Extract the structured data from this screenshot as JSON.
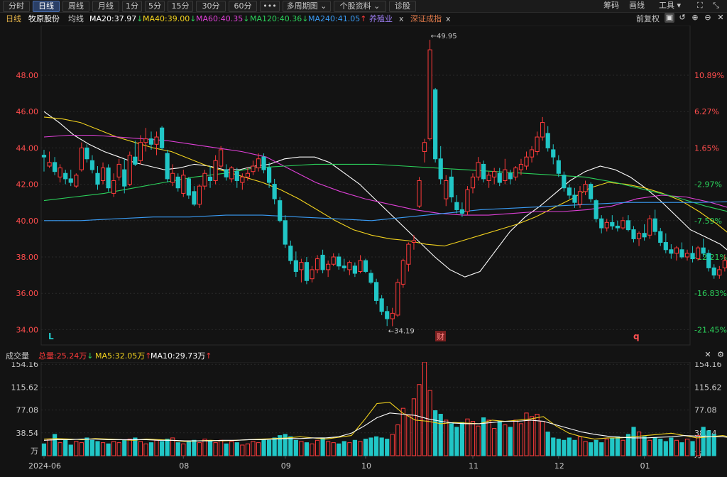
{
  "toolbar": {
    "periods": [
      "分时",
      "日线",
      "周线",
      "月线",
      "1分",
      "5分",
      "15分",
      "30分",
      "60分",
      "•••",
      "多周期图",
      "个股资料",
      "诊股"
    ],
    "active_period": "日线",
    "right_items": [
      "筹码",
      "画线",
      "工具"
    ]
  },
  "header": {
    "period": "日线",
    "stock_name": "牧原股份",
    "avg_label": "均线",
    "ma_items": [
      {
        "label": "MA20:37.97",
        "arrow": "↓",
        "color": "#ffffff"
      },
      {
        "label": "MA40:39.00",
        "arrow": "↓",
        "color": "#f2d21e"
      },
      {
        "label": "MA60:40.35",
        "arrow": "↓",
        "color": "#e040d8"
      },
      {
        "label": "MA120:40.36",
        "arrow": "↓",
        "color": "#2bd15b"
      },
      {
        "label": "MA240:41.05",
        "arrow": "↑",
        "color": "#3a9cf5"
      }
    ],
    "tags": [
      {
        "label": "养殖业",
        "close": "x",
        "color": "#9b7cf0"
      },
      {
        "label": "深证成指",
        "close": "x",
        "color": "#e07a4a"
      }
    ],
    "adjust": "前复权"
  },
  "chart_data": {
    "type": "candlestick",
    "price_axis": {
      "ticks": [
        48,
        46,
        44,
        42,
        40,
        38,
        36,
        34
      ],
      "labels": [
        "48.00",
        "46.00",
        "44.00",
        "42.00",
        "40.00",
        "38.00",
        "36.00",
        "34.00"
      ],
      "range": [
        33.6,
        50.2
      ]
    },
    "pct_axis": {
      "labels": [
        "10.89%",
        "6.27%",
        "1.65%",
        "-2.97%",
        "-7.59%",
        "-12.21%",
        "-16.83%",
        "-21.45%"
      ]
    },
    "x_labels": [
      "2024-06",
      "08",
      "09",
      "10",
      "11",
      "12",
      "01"
    ],
    "annotations": {
      "high": "49.95",
      "low": "34.19"
    },
    "markers": [
      "L",
      "财",
      "q"
    ],
    "up_color": "#ff3b3b",
    "down_color": "#21c6c6",
    "candles": [
      [
        43.6,
        43.9,
        42.7,
        43.5
      ],
      [
        43.0,
        43.8,
        42.9,
        43.2
      ],
      [
        43.2,
        43.5,
        42.5,
        42.7
      ],
      [
        42.4,
        43.1,
        42.1,
        42.9
      ],
      [
        42.6,
        42.8,
        42.0,
        42.3
      ],
      [
        42.3,
        42.8,
        41.9,
        42.1
      ],
      [
        41.9,
        42.6,
        41.8,
        42.5
      ],
      [
        42.8,
        44.3,
        42.7,
        44.0
      ],
      [
        44.0,
        44.2,
        43.2,
        43.4
      ],
      [
        43.3,
        43.6,
        42.6,
        42.8
      ],
      [
        42.6,
        43.0,
        41.7,
        42.0
      ],
      [
        42.2,
        43.2,
        42.0,
        42.9
      ],
      [
        42.9,
        43.1,
        41.6,
        41.8
      ],
      [
        41.5,
        42.6,
        41.3,
        42.2
      ],
      [
        42.4,
        43.4,
        42.2,
        43.1
      ],
      [
        42.8,
        43.4,
        41.5,
        41.9
      ],
      [
        42.0,
        43.8,
        41.9,
        43.6
      ],
      [
        43.5,
        44.4,
        43.0,
        43.1
      ],
      [
        43.3,
        44.7,
        43.1,
        44.3
      ],
      [
        44.3,
        45.1,
        43.8,
        44.5
      ],
      [
        44.5,
        44.9,
        43.9,
        44.2
      ],
      [
        44.2,
        44.9,
        43.6,
        44.6
      ],
      [
        45.1,
        45.2,
        43.9,
        44.0
      ],
      [
        43.7,
        43.9,
        42.1,
        42.3
      ],
      [
        42.1,
        43.1,
        41.9,
        42.6
      ],
      [
        42.4,
        42.6,
        41.6,
        41.8
      ],
      [
        41.5,
        42.8,
        41.3,
        42.5
      ],
      [
        42.3,
        42.4,
        41.2,
        41.4
      ],
      [
        41.6,
        41.9,
        40.8,
        40.9
      ],
      [
        40.9,
        42.0,
        40.7,
        41.9
      ],
      [
        41.9,
        42.8,
        41.7,
        42.6
      ],
      [
        42.4,
        43.0,
        41.8,
        42.2
      ],
      [
        42.2,
        43.6,
        42.0,
        43.3
      ],
      [
        43.0,
        44.1,
        42.9,
        43.9
      ],
      [
        42.8,
        43.1,
        42.2,
        42.4
      ],
      [
        42.3,
        43.0,
        42.1,
        42.9
      ],
      [
        42.7,
        42.9,
        41.8,
        42.2
      ],
      [
        42.1,
        42.6,
        41.7,
        42.4
      ],
      [
        42.4,
        42.9,
        42.2,
        42.6
      ],
      [
        42.7,
        43.3,
        42.5,
        43.0
      ],
      [
        42.9,
        43.7,
        42.7,
        43.4
      ],
      [
        43.5,
        43.7,
        42.6,
        42.8
      ],
      [
        42.9,
        43.2,
        41.8,
        42.1
      ],
      [
        42.0,
        42.3,
        40.9,
        41.2
      ],
      [
        41.1,
        41.3,
        39.9,
        40.0
      ],
      [
        40.0,
        40.3,
        38.5,
        38.7
      ],
      [
        38.6,
        38.9,
        37.6,
        37.8
      ],
      [
        37.8,
        38.3,
        36.9,
        37.2
      ],
      [
        37.3,
        37.9,
        36.6,
        37.7
      ],
      [
        37.7,
        38.0,
        36.5,
        36.7
      ],
      [
        36.8,
        37.5,
        36.6,
        37.3
      ],
      [
        37.3,
        38.1,
        37.1,
        37.9
      ],
      [
        38.1,
        38.4,
        37.1,
        37.3
      ],
      [
        37.3,
        37.8,
        36.9,
        37.6
      ],
      [
        37.6,
        38.2,
        37.5,
        38.0
      ],
      [
        38.0,
        38.2,
        37.3,
        37.5
      ],
      [
        37.5,
        37.9,
        37.2,
        37.4
      ],
      [
        37.3,
        37.8,
        37.0,
        37.7
      ],
      [
        37.5,
        37.7,
        36.9,
        37.1
      ],
      [
        37.2,
        38.1,
        37.1,
        37.8
      ],
      [
        37.8,
        37.9,
        37.1,
        37.2
      ],
      [
        37.1,
        37.3,
        36.5,
        36.6
      ],
      [
        36.6,
        36.8,
        35.4,
        35.6
      ],
      [
        35.7,
        35.9,
        34.8,
        35.0
      ],
      [
        35.0,
        35.3,
        34.2,
        34.6
      ],
      [
        34.6,
        35.2,
        34.19,
        34.9
      ],
      [
        34.8,
        36.8,
        34.7,
        36.6
      ],
      [
        36.5,
        37.9,
        36.3,
        37.8
      ],
      [
        37.6,
        38.8,
        37.2,
        38.7
      ],
      [
        38.8,
        39.2,
        38.4,
        38.9
      ],
      [
        40.8,
        42.4,
        40.7,
        42.2
      ],
      [
        43.8,
        44.5,
        43.2,
        44.3
      ],
      [
        44.5,
        49.95,
        44.4,
        49.4
      ],
      [
        47.2,
        47.3,
        43.2,
        43.4
      ],
      [
        43.4,
        44.1,
        42.0,
        42.3
      ],
      [
        41.2,
        42.5,
        40.8,
        42.2
      ],
      [
        42.4,
        42.8,
        41.0,
        41.3
      ],
      [
        41.0,
        41.4,
        40.4,
        40.6
      ],
      [
        40.6,
        41.0,
        40.2,
        40.4
      ],
      [
        40.5,
        41.9,
        40.3,
        41.7
      ],
      [
        41.8,
        42.6,
        41.5,
        42.4
      ],
      [
        42.4,
        43.5,
        42.2,
        43.2
      ],
      [
        43.1,
        43.3,
        42.1,
        42.3
      ],
      [
        42.2,
        42.7,
        41.8,
        42.5
      ],
      [
        42.4,
        42.9,
        42.0,
        42.7
      ],
      [
        42.6,
        42.9,
        41.9,
        42.1
      ],
      [
        42.2,
        43.4,
        42.0,
        42.8
      ],
      [
        42.6,
        42.8,
        42.0,
        42.3
      ],
      [
        42.4,
        43.0,
        42.2,
        42.9
      ],
      [
        42.8,
        43.4,
        42.5,
        43.1
      ],
      [
        43.0,
        43.8,
        42.8,
        43.5
      ],
      [
        43.5,
        44.1,
        43.2,
        43.9
      ],
      [
        43.8,
        44.9,
        43.6,
        44.6
      ],
      [
        44.6,
        45.7,
        44.4,
        45.4
      ],
      [
        44.8,
        45.2,
        43.8,
        44.0
      ],
      [
        43.9,
        44.2,
        43.1,
        43.5
      ],
      [
        43.3,
        43.6,
        42.4,
        42.6
      ],
      [
        42.5,
        42.7,
        41.6,
        41.8
      ],
      [
        41.8,
        42.0,
        41.2,
        41.4
      ],
      [
        41.4,
        41.8,
        40.7,
        41.0
      ],
      [
        40.9,
        41.9,
        40.7,
        41.6
      ],
      [
        41.6,
        42.2,
        41.4,
        42.0
      ],
      [
        42.0,
        42.1,
        41.0,
        41.2
      ],
      [
        41.1,
        41.2,
        39.9,
        40.1
      ],
      [
        40.1,
        40.3,
        39.3,
        39.6
      ],
      [
        39.6,
        40.1,
        39.4,
        39.9
      ],
      [
        39.9,
        40.3,
        39.5,
        39.7
      ],
      [
        39.7,
        40.0,
        39.4,
        39.6
      ],
      [
        39.6,
        40.2,
        39.5,
        40.0
      ],
      [
        40.0,
        40.3,
        39.4,
        39.5
      ],
      [
        39.5,
        39.7,
        38.8,
        39.0
      ],
      [
        39.0,
        39.4,
        38.6,
        39.3
      ],
      [
        39.3,
        39.8,
        38.9,
        39.1
      ],
      [
        39.2,
        40.3,
        39.0,
        40.1
      ],
      [
        40.1,
        40.6,
        39.2,
        39.4
      ],
      [
        39.4,
        39.6,
        38.6,
        38.8
      ],
      [
        38.8,
        39.3,
        38.2,
        38.4
      ],
      [
        38.4,
        38.7,
        37.9,
        38.2
      ],
      [
        38.2,
        38.6,
        37.8,
        38.5
      ],
      [
        38.4,
        38.8,
        37.9,
        38.0
      ],
      [
        38.0,
        38.4,
        37.8,
        38.2
      ],
      [
        38.2,
        38.6,
        37.7,
        37.9
      ],
      [
        37.9,
        38.6,
        37.8,
        38.5
      ],
      [
        38.5,
        39.0,
        38.0,
        38.2
      ],
      [
        38.2,
        38.4,
        37.2,
        37.4
      ],
      [
        37.4,
        37.6,
        36.8,
        37.0
      ],
      [
        37.0,
        37.5,
        36.8,
        37.3
      ],
      [
        37.4,
        38.1,
        37.2,
        37.8
      ],
      [
        37.6,
        37.7,
        36.1,
        36.3
      ],
      [
        36.0,
        36.4,
        35.8,
        36.3
      ]
    ],
    "ma_series": [
      {
        "name": "MA20",
        "color": "#ffffff",
        "values": [
          46.0,
          45.4,
          44.7,
          44.2,
          43.8,
          43.5,
          43.2,
          43.0,
          42.8,
          42.9,
          43.1,
          43.0,
          42.8,
          42.8,
          43.0,
          43.1,
          43.4,
          43.5,
          43.5,
          43.2,
          42.6,
          42.0,
          41.2,
          40.4,
          39.6,
          38.8,
          38.0,
          37.3,
          36.9,
          37.2,
          38.3,
          39.4,
          40.2,
          40.8,
          41.5,
          42.2,
          42.7,
          43.0,
          42.8,
          42.4,
          41.8,
          41.1,
          40.3,
          39.5,
          39.1,
          38.7,
          38.0
        ]
      },
      {
        "name": "MA40",
        "color": "#f2d21e",
        "values": [
          45.7,
          45.6,
          45.4,
          45.0,
          44.6,
          44.3,
          44.0,
          43.8,
          43.4,
          43.0,
          42.7,
          42.4,
          42.1,
          41.7,
          41.2,
          40.6,
          40.0,
          39.5,
          39.2,
          39.0,
          38.9,
          38.7,
          38.6,
          38.9,
          39.2,
          39.5,
          39.8,
          40.2,
          40.7,
          41.2,
          41.8,
          42.1,
          42.0,
          41.8,
          41.5,
          41.1,
          40.5,
          39.8,
          39.0
        ]
      },
      {
        "name": "MA60",
        "color": "#e040d8",
        "values": [
          44.6,
          44.7,
          44.7,
          44.6,
          44.5,
          44.4,
          44.2,
          44.0,
          43.8,
          43.5,
          42.8,
          42.1,
          41.6,
          41.2,
          40.9,
          40.6,
          40.4,
          40.3,
          40.3,
          40.4,
          40.5,
          40.5,
          40.6,
          40.8,
          41.2,
          41.4,
          41.3,
          41.0,
          40.6
        ]
      },
      {
        "name": "MA120",
        "color": "#2bd15b",
        "values": [
          41.1,
          41.3,
          41.5,
          41.8,
          42.1,
          42.4,
          42.6,
          42.9,
          43.0,
          43.1,
          43.1,
          43.1,
          43.0,
          42.9,
          42.8,
          42.7,
          42.6,
          42.5,
          42.4,
          42.1,
          41.7,
          41.3,
          40.8,
          40.4
        ]
      },
      {
        "name": "MA240",
        "color": "#3a9cf5",
        "values": [
          40.0,
          40.0,
          40.1,
          40.2,
          40.2,
          40.3,
          40.3,
          40.2,
          40.1,
          40.0,
          40.2,
          40.4,
          40.6,
          40.7,
          40.8,
          40.9,
          41.0,
          41.0,
          41.0,
          41.05
        ]
      }
    ],
    "volume": {
      "axis_labels": [
        "154.16",
        "115.62",
        "77.08",
        "38.54",
        "万"
      ],
      "ticks": [
        154.16,
        115.62,
        77.08,
        38.54
      ],
      "max": 158,
      "values": [
        20,
        28,
        36,
        22,
        26,
        18,
        24,
        22,
        30,
        26,
        24,
        22,
        20,
        24,
        22,
        26,
        28,
        30,
        24,
        20,
        22,
        26,
        24,
        28,
        30,
        22,
        20,
        24,
        26,
        22,
        28,
        24,
        22,
        26,
        20,
        24,
        22,
        18,
        20,
        24,
        22,
        28,
        26,
        30,
        34,
        36,
        32,
        26,
        24,
        22,
        20,
        26,
        30,
        24,
        22,
        20,
        24,
        22,
        26,
        24,
        28,
        30,
        32,
        30,
        28,
        36,
        52,
        80,
        68,
        96,
        120,
        158,
        110,
        76,
        70,
        60,
        54,
        48,
        56,
        62,
        58,
        50,
        64,
        60,
        46,
        58,
        52,
        48,
        60,
        54,
        72,
        66,
        70,
        58,
        40,
        30,
        28,
        26,
        30,
        26,
        32,
        24,
        22,
        26,
        22,
        28,
        30,
        32,
        26,
        36,
        48,
        40,
        32,
        26,
        30,
        28,
        24,
        30,
        26,
        22,
        28,
        24,
        34,
        48,
        42,
        36
      ],
      "ma_series": [
        {
          "name": "MA5",
          "color": "#f2d21e",
          "values": [
            28,
            29,
            28,
            27,
            29,
            28,
            27,
            26,
            28,
            27,
            26,
            24,
            25,
            26,
            25,
            26,
            27,
            28,
            29,
            30,
            32,
            30,
            28,
            31,
            34,
            60,
            88,
            90,
            72,
            60,
            58,
            54,
            56,
            55,
            54,
            60,
            58,
            60,
            62,
            66,
            50,
            38,
            32,
            28,
            30,
            30,
            32,
            34,
            36,
            38,
            34,
            30,
            32,
            34,
            30
          ]
        },
        {
          "name": "MA10",
          "color": "#ffffff",
          "values": [
            26,
            27,
            27,
            28,
            28,
            27,
            27,
            27,
            27,
            26,
            26,
            25,
            25,
            25,
            26,
            26,
            27,
            27,
            28,
            29,
            29,
            30,
            30,
            32,
            38,
            50,
            64,
            72,
            70,
            68,
            62,
            58,
            55,
            54,
            54,
            56,
            58,
            58,
            60,
            58,
            52,
            46,
            40,
            36,
            33,
            31,
            30,
            30,
            31,
            32,
            34,
            33,
            32,
            32,
            29.73
          ]
        }
      ]
    }
  },
  "volume_header": {
    "title": "成交量",
    "items": [
      {
        "label": "总量:25.24万",
        "arrow": "↓",
        "color": "#ff3b3b",
        "arrow_color": "#2bd15b"
      },
      {
        "label": "MA5:32.05万",
        "arrow": "↑",
        "color": "#f2d21e",
        "arrow_color": "#ff3b3b"
      },
      {
        "label": "MA10:29.73万",
        "arrow": "↑",
        "color": "#ffffff",
        "arrow_color": "#ff3b3b"
      }
    ]
  }
}
